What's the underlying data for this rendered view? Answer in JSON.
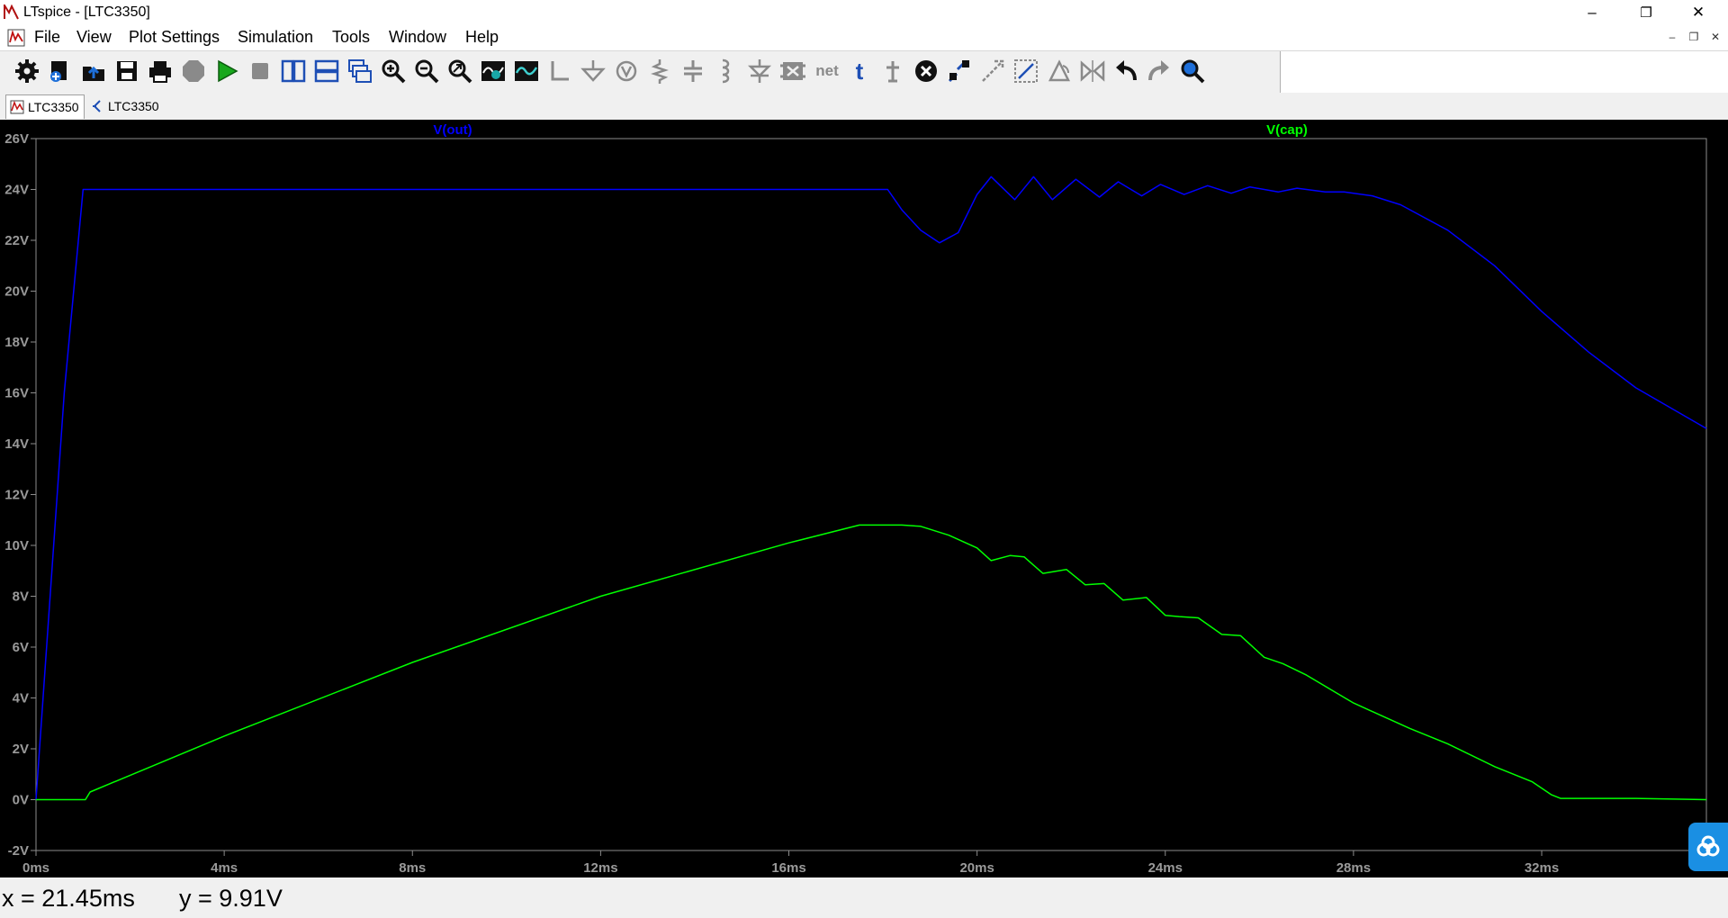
{
  "window": {
    "title": "LTspice - [LTC3350]",
    "minimize": "–",
    "restore": "❐",
    "close": "✕"
  },
  "menu": {
    "items": [
      "File",
      "View",
      "Plot Settings",
      "Simulation",
      "Tools",
      "Window",
      "Help"
    ]
  },
  "toolbar": {
    "buttons": [
      "gear-icon",
      "new-schematic-icon",
      "open-icon",
      "save-icon",
      "print-icon",
      "halt-icon",
      "run-icon",
      "stop-icon",
      "tile-vertical-icon",
      "tile-horizontal-icon",
      "cascade-icon",
      "zoom-in-icon",
      "zoom-out-icon",
      "zoom-fit-icon",
      "autorange-icon",
      "add-trace-icon",
      "wire-icon",
      "ground-icon",
      "label-icon",
      "resistor-icon",
      "capacitor-icon",
      "inductor-icon",
      "diode-icon",
      "component-icon",
      "net-label-icon",
      "text-icon",
      "spice-directive-icon",
      "delete-icon",
      "duplicate-icon",
      "move-icon",
      "drag-icon",
      "rotate-icon",
      "mirror-icon",
      "undo-icon",
      "redo-icon",
      "find-icon"
    ],
    "net_text": "net",
    "text_glyph": "t"
  },
  "tabs": [
    {
      "label": "LTC3350",
      "kind": "waveform",
      "active": true
    },
    {
      "label": "LTC3350",
      "kind": "schematic",
      "active": false
    }
  ],
  "chart_data": {
    "type": "line",
    "xlabel": "",
    "ylabel": "",
    "xlim": [
      0,
      35.5
    ],
    "ylim": [
      -2,
      26
    ],
    "xticks": [
      0,
      4,
      8,
      12,
      16,
      20,
      24,
      28,
      32
    ],
    "xtick_labels": [
      "0ms",
      "4ms",
      "8ms",
      "12ms",
      "16ms",
      "20ms",
      "24ms",
      "28ms",
      "32ms"
    ],
    "yticks": [
      -2,
      0,
      2,
      4,
      6,
      8,
      10,
      12,
      14,
      16,
      18,
      20,
      22,
      24,
      26
    ],
    "ytick_labels": [
      "-2V",
      "0V",
      "2V",
      "4V",
      "6V",
      "8V",
      "10V",
      "12V",
      "14V",
      "16V",
      "18V",
      "20V",
      "22V",
      "24V",
      "26V"
    ],
    "grid": false,
    "background": "#000000",
    "series": [
      {
        "name": "V(out)",
        "color": "#0000ff",
        "x": [
          0,
          0.3,
          0.6,
          1.0,
          18.1,
          18.4,
          18.8,
          19.2,
          19.6,
          20.0,
          20.3,
          20.8,
          21.2,
          21.6,
          22.1,
          22.6,
          23.0,
          23.5,
          23.9,
          24.4,
          24.9,
          25.4,
          25.8,
          26.4,
          26.8,
          27.4,
          27.8,
          28.4,
          29.0,
          30.0,
          31.0,
          32.0,
          33.0,
          34.0,
          35.5
        ],
        "values": [
          0,
          8,
          16,
          24,
          24,
          23.2,
          22.4,
          21.9,
          22.3,
          23.8,
          24.5,
          23.6,
          24.5,
          23.6,
          24.4,
          23.7,
          24.3,
          23.75,
          24.2,
          23.8,
          24.15,
          23.85,
          24.1,
          23.9,
          24.05,
          23.9,
          23.9,
          23.75,
          23.4,
          22.4,
          21.0,
          19.2,
          17.6,
          16.2,
          14.6
        ]
      },
      {
        "name": "V(cap)",
        "color": "#00ff00",
        "x": [
          0,
          1.05,
          1.15,
          4,
          8,
          12,
          16,
          17.5,
          18.0,
          18.4,
          18.8,
          19.4,
          20.0,
          20.3,
          20.7,
          21.0,
          21.4,
          21.9,
          22.3,
          22.7,
          23.1,
          23.6,
          24.0,
          24.3,
          24.7,
          25.2,
          25.6,
          26.1,
          26.5,
          27.0,
          27.5,
          28.0,
          28.6,
          29.2,
          30.0,
          31.0,
          31.8,
          32.2,
          32.4,
          34.0,
          35.5
        ],
        "values": [
          0,
          0,
          0.3,
          2.5,
          5.4,
          8.0,
          10.1,
          10.8,
          10.8,
          10.8,
          10.75,
          10.4,
          9.9,
          9.4,
          9.6,
          9.55,
          8.9,
          9.05,
          8.45,
          8.5,
          7.85,
          7.95,
          7.25,
          7.2,
          7.15,
          6.5,
          6.45,
          5.6,
          5.35,
          4.9,
          4.35,
          3.8,
          3.3,
          2.8,
          2.2,
          1.3,
          0.7,
          0.2,
          0.05,
          0.05,
          0.0
        ]
      }
    ]
  },
  "cursor_readout": {
    "x": "x = 21.45ms",
    "y": "y = 9.91V"
  }
}
